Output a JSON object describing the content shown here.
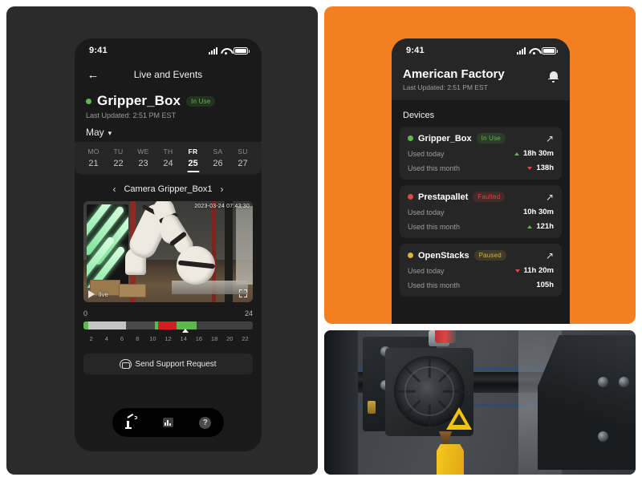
{
  "left_panel": {
    "background_color": "#2b2b2b",
    "status_bar": {
      "time": "9:41",
      "icons": [
        "cellular-icon",
        "wifi-icon",
        "battery-icon"
      ]
    },
    "nav": {
      "back_icon": "←",
      "title": "Live and Events"
    },
    "device": {
      "status_dot_color": "#5cba4c",
      "name": "Gripper_Box",
      "badge": "In Use",
      "last_updated": "Last Updated: 2:51 PM EST"
    },
    "month_selector": {
      "label": "May",
      "chevron": "⌄"
    },
    "week": {
      "days": [
        {
          "dow": "MO",
          "num": "21",
          "active": false
        },
        {
          "dow": "TU",
          "num": "22",
          "active": false
        },
        {
          "dow": "WE",
          "num": "23",
          "active": false
        },
        {
          "dow": "TH",
          "num": "24",
          "active": false
        },
        {
          "dow": "FR",
          "num": "25",
          "active": true
        },
        {
          "dow": "SA",
          "num": "26",
          "active": false
        },
        {
          "dow": "SU",
          "num": "27",
          "active": false
        }
      ]
    },
    "camera_nav": {
      "prev": "‹",
      "label": "Camera Gripper_Box1",
      "next": "›"
    },
    "video": {
      "timestamp": "2023-03-24 07:43:30",
      "play_label": "live",
      "fullscreen_icon": "fullscreen-icon"
    },
    "timeline": {
      "start_label": "0",
      "end_label": "24",
      "tick_labels": [
        "2",
        "4",
        "6",
        "8",
        "10",
        "12",
        "14",
        "16",
        "18",
        "20",
        "22"
      ],
      "marker_position_pct": 60,
      "segments": [
        {
          "color": "#5cba4c",
          "width_pct": 3
        },
        {
          "color": "#c6c6c6",
          "width_pct": 22
        },
        {
          "color": "#4a4a4a",
          "width_pct": 17
        },
        {
          "color": "#5cba4c",
          "width_pct": 2
        },
        {
          "color": "#cc2222",
          "width_pct": 11
        },
        {
          "color": "#5cba4c",
          "width_pct": 12
        },
        {
          "color": "#3f3f3f",
          "width_pct": 33
        }
      ]
    },
    "support_button": {
      "label": "Send Support Request",
      "icon": "headset-icon"
    },
    "tab_bar": {
      "tabs": [
        {
          "name": "robot-arm-icon"
        },
        {
          "name": "bar-chart-icon"
        },
        {
          "name": "help-icon",
          "glyph": "?"
        }
      ]
    }
  },
  "right_panel": {
    "background_color": "#f28022",
    "status_bar": {
      "time": "9:41"
    },
    "header": {
      "title": "American Factory",
      "last_updated": "Last Updated: 2:51 PM EST",
      "bell_icon": "bell-icon"
    },
    "section_label": "Devices",
    "devices": [
      {
        "name": "Gripper_Box",
        "status": "In Use",
        "status_class": "inuse",
        "dot_color": "#5cba4c",
        "open_icon": "↗",
        "metrics": [
          {
            "label": "Used today",
            "value": "18h 30m",
            "trend": "up"
          },
          {
            "label": "Used this month",
            "value": "138h",
            "trend": "down"
          }
        ]
      },
      {
        "name": "Prestapallet",
        "status": "Faulted",
        "status_class": "faulted",
        "dot_color": "#d94c3f",
        "open_icon": "↗",
        "metrics": [
          {
            "label": "Used today",
            "value": "10h 30m",
            "trend": "none"
          },
          {
            "label": "Used this month",
            "value": "121h",
            "trend": "up"
          }
        ]
      },
      {
        "name": "OpenStacks",
        "status": "Paused",
        "status_class": "paused",
        "dot_color": "#d9b23f",
        "open_icon": "↗",
        "metrics": [
          {
            "label": "Used today",
            "value": "11h 20m",
            "trend": "down"
          },
          {
            "label": "Used this month",
            "value": "105h",
            "trend": "none"
          }
        ]
      }
    ]
  },
  "photo_panel": {
    "subject": "3d-printer-extruder-photo"
  }
}
